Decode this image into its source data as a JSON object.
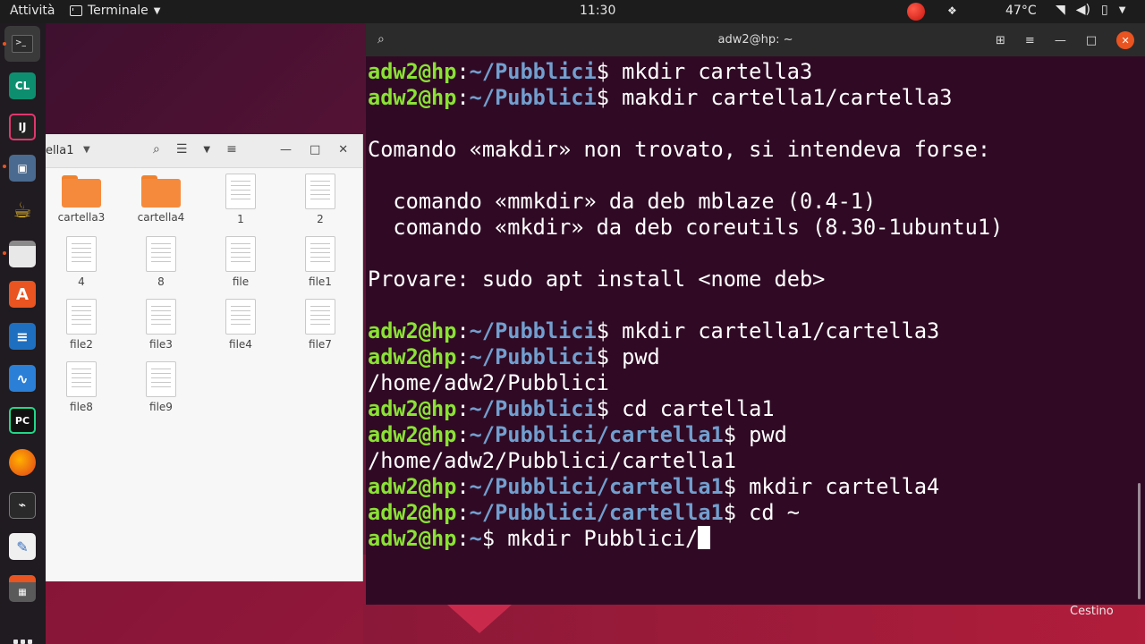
{
  "topbar": {
    "activities": "Attività",
    "app_name": "Terminale",
    "clock": "11:30",
    "temperature": "47°C"
  },
  "dock": {
    "items": [
      "terminal-icon",
      "clion-icon",
      "intellij-icon",
      "virt-manager-icon",
      "teapot-icon",
      "files-icon",
      "software-center-icon",
      "libreoffice-writer-icon",
      "system-monitor-icon",
      "pycharm-icon",
      "firefox-icon",
      "activity-monitor-icon",
      "text-editor-icon",
      "calculator-icon"
    ],
    "clion_label": "CL",
    "intellij_label": "IJ",
    "pycharm_label": "PC",
    "software_label": "A"
  },
  "file_manager": {
    "path_label": "ella1",
    "items": [
      {
        "name": "cartella3",
        "type": "folder"
      },
      {
        "name": "cartella4",
        "type": "folder"
      },
      {
        "name": "1",
        "type": "file"
      },
      {
        "name": "2",
        "type": "file"
      },
      {
        "name": "4",
        "type": "file"
      },
      {
        "name": "8",
        "type": "file"
      },
      {
        "name": "file",
        "type": "file"
      },
      {
        "name": "file1",
        "type": "file"
      },
      {
        "name": "file2",
        "type": "file"
      },
      {
        "name": "file3",
        "type": "file"
      },
      {
        "name": "file4",
        "type": "file"
      },
      {
        "name": "file7",
        "type": "file"
      },
      {
        "name": "file8",
        "type": "file"
      },
      {
        "name": "file9",
        "type": "file"
      }
    ]
  },
  "terminal": {
    "title": "adw2@hp: ~",
    "prompt_user": "adw2@hp",
    "lines": [
      {
        "kind": "prompt",
        "path": "~/Pubblici",
        "cmd": " mkdir cartella3"
      },
      {
        "kind": "prompt",
        "path": "~/Pubblici",
        "cmd": " makdir cartella1/cartella3"
      },
      {
        "kind": "out",
        "text": ""
      },
      {
        "kind": "out",
        "text": "Comando «makdir» non trovato, si intendeva forse:"
      },
      {
        "kind": "out",
        "text": ""
      },
      {
        "kind": "out",
        "text": "  comando «mmkdir» da deb mblaze (0.4-1)"
      },
      {
        "kind": "out",
        "text": "  comando «mkdir» da deb coreutils (8.30-1ubuntu1)"
      },
      {
        "kind": "out",
        "text": ""
      },
      {
        "kind": "out",
        "text": "Provare: sudo apt install <nome deb>"
      },
      {
        "kind": "out",
        "text": ""
      },
      {
        "kind": "prompt",
        "path": "~/Pubblici",
        "cmd": " mkdir cartella1/cartella3"
      },
      {
        "kind": "prompt",
        "path": "~/Pubblici",
        "cmd": " pwd"
      },
      {
        "kind": "out",
        "text": "/home/adw2/Pubblici"
      },
      {
        "kind": "prompt",
        "path": "~/Pubblici",
        "cmd": " cd cartella1"
      },
      {
        "kind": "prompt",
        "path": "~/Pubblici/cartella1",
        "cmd": " pwd"
      },
      {
        "kind": "out",
        "text": "/home/adw2/Pubblici/cartella1"
      },
      {
        "kind": "prompt",
        "path": "~/Pubblici/cartella1",
        "cmd": " mkdir cartella4"
      },
      {
        "kind": "prompt",
        "path": "~/Pubblici/cartella1",
        "cmd": " cd ~"
      },
      {
        "kind": "prompt",
        "path": "~",
        "cmd": " mkdir Pubblici/",
        "cursor": true
      }
    ]
  },
  "desktop": {
    "trash_label": "Cestino"
  }
}
